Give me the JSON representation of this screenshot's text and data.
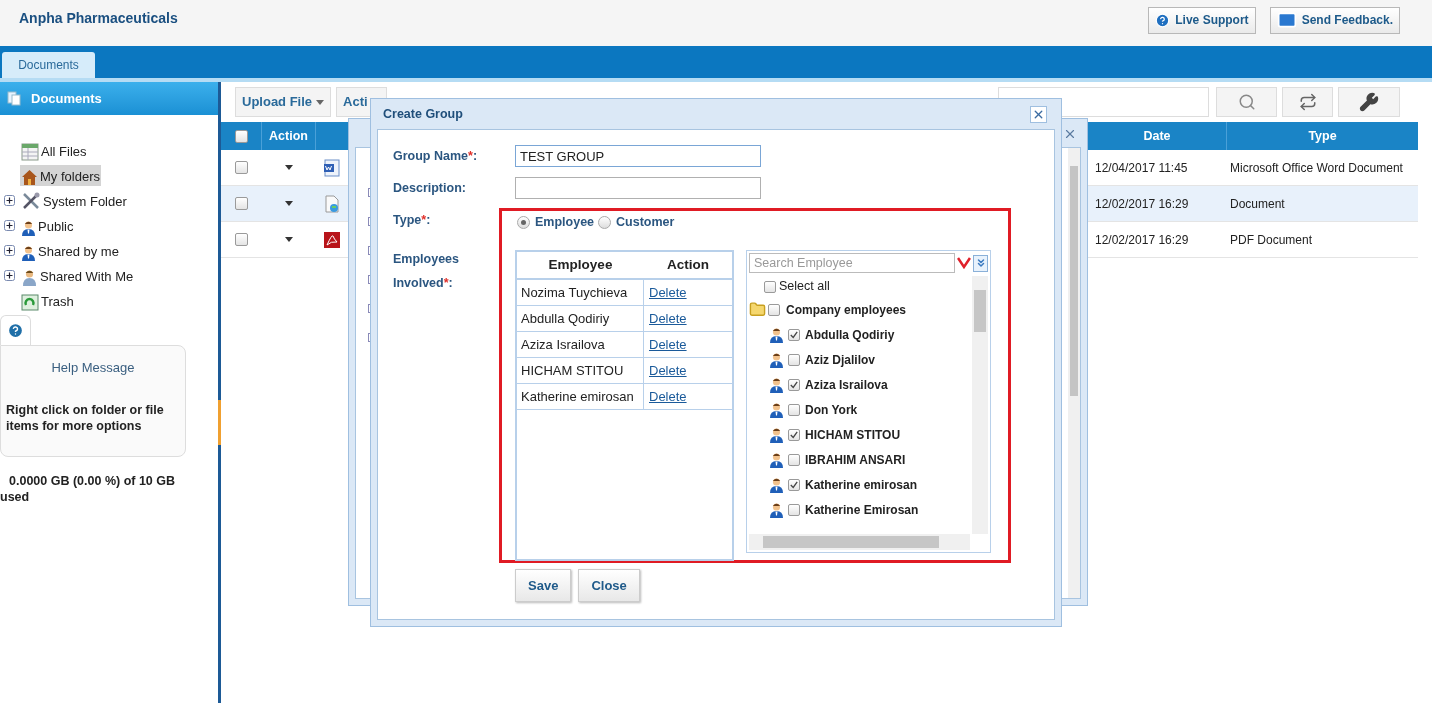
{
  "header": {
    "title": "Anpha Pharmaceuticals",
    "buttons": [
      {
        "label": "Live Support",
        "kind": "help"
      },
      {
        "label": "Send Feedback.",
        "kind": "mail"
      }
    ]
  },
  "tabs": [
    {
      "label": "Documents",
      "selected": true
    }
  ],
  "sidebar": {
    "title": "Documents",
    "tree": [
      {
        "label": "All Files",
        "kind": "files",
        "has_children": false,
        "selected": false
      },
      {
        "label": "My folders",
        "kind": "home",
        "has_children": false,
        "selected": true
      },
      {
        "label": "System Folder",
        "kind": "tools",
        "has_children": true,
        "selected": false
      },
      {
        "label": "Public",
        "kind": "user",
        "has_children": true,
        "selected": false
      },
      {
        "label": "Shared by me",
        "kind": "user",
        "has_children": true,
        "selected": false
      },
      {
        "label": "Shared With Me",
        "kind": "shared",
        "has_children": true,
        "selected": false
      },
      {
        "label": "Trash",
        "kind": "trash",
        "has_children": false,
        "selected": false
      }
    ],
    "help": {
      "title": "Help Message",
      "text": "Right click on folder or file items for more options"
    },
    "storage": "0.0000 GB (0.00 %) of 10 GB used"
  },
  "toolbar": {
    "buttons": [
      {
        "label": "Upload File"
      },
      {
        "label": "Acti"
      }
    ],
    "tools": [
      {
        "kind": "search"
      },
      {
        "kind": "refresh"
      },
      {
        "kind": "settings"
      }
    ]
  },
  "table": {
    "all_checked": false,
    "columns": [
      "Action",
      "Date",
      "Type"
    ],
    "rows": [
      {
        "checked": false,
        "selected": false,
        "kind": "word",
        "date": "12/04/2017 11:45",
        "type": "Microsoft Office Word Document"
      },
      {
        "checked": false,
        "selected": true,
        "kind": "web",
        "date": "12/02/2017 16:29",
        "type": "Document"
      },
      {
        "checked": false,
        "selected": false,
        "kind": "pdf",
        "date": "12/02/2017 16:29",
        "type": "PDF Document"
      }
    ]
  },
  "dialog": {
    "title": "Create Group",
    "fields": [
      {
        "label": "Group Name",
        "required_mark": "*",
        "suffix": ":",
        "value": "TEST GROUP",
        "focused": true
      },
      {
        "label": "Description:",
        "focused": false
      }
    ],
    "type": {
      "label": "Type",
      "required_mark": "*",
      "suffix": ":",
      "options": [
        {
          "label": "Employee",
          "selected": true
        },
        {
          "label": "Customer",
          "selected": false
        }
      ]
    },
    "employees": {
      "label": "Employees Involved",
      "required_mark": "*",
      "suffix": ":",
      "columns": [
        "Employee",
        "Action"
      ],
      "rows": [
        {
          "name": "Nozima Tuychieva",
          "action": "Delete"
        },
        {
          "name": "Abdulla Qodiriy",
          "action": "Delete"
        },
        {
          "name": "Aziza Israilova",
          "action": "Delete"
        },
        {
          "name": "HICHAM STITOU",
          "action": "Delete"
        },
        {
          "name": "Katherine emirosan",
          "action": "Delete"
        }
      ]
    },
    "picker": {
      "placeholder": "Search Employee",
      "select_all": {
        "label": "Select all",
        "checked": false
      },
      "group": {
        "label": "Company employees",
        "checked": false
      },
      "items": [
        {
          "label": "Abdulla Qodiriy",
          "checked": true
        },
        {
          "label": "Aziz Djalilov",
          "checked": false
        },
        {
          "label": "Aziza Israilova",
          "checked": true
        },
        {
          "label": "Don York",
          "checked": false
        },
        {
          "label": "HICHAM STITOU",
          "checked": true
        },
        {
          "label": "IBRAHIM ANSARI",
          "checked": false
        },
        {
          "label": "Katherine emirosan",
          "checked": true
        },
        {
          "label": "Katherine Emirosan",
          "checked": false
        }
      ]
    },
    "buttons": [
      {
        "label": "Save"
      },
      {
        "label": "Close"
      }
    ]
  }
}
